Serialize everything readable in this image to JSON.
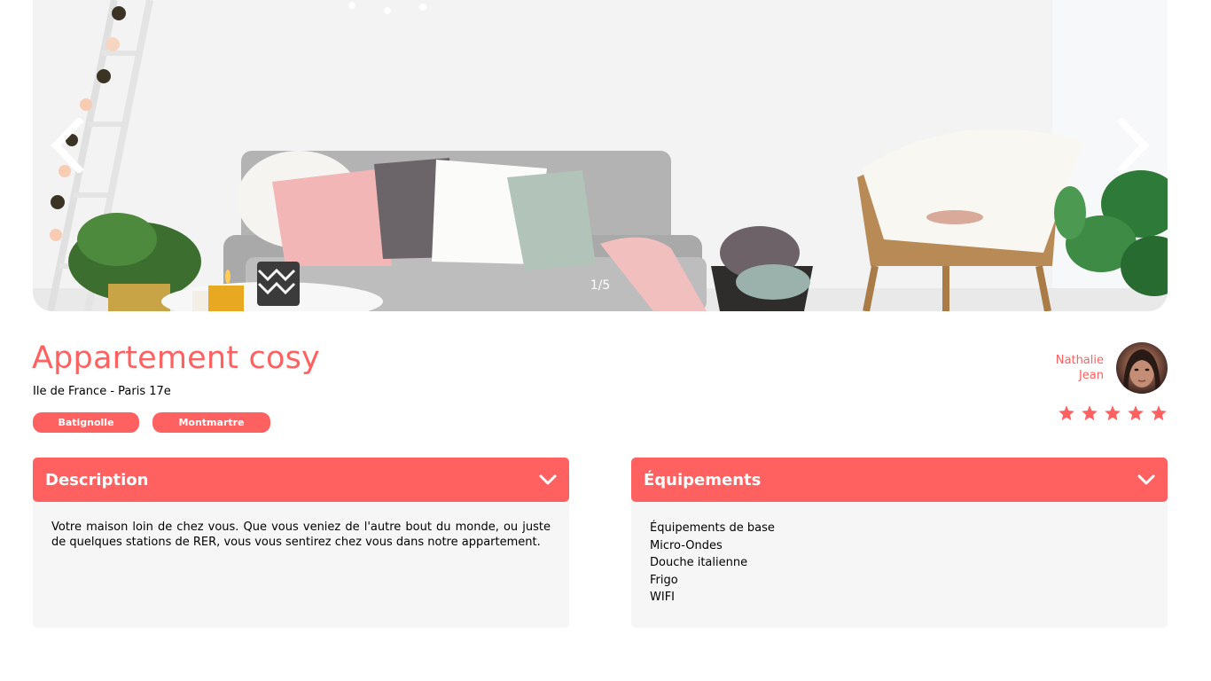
{
  "carousel": {
    "counter": "1/5",
    "prev_icon": "chevron-left-icon",
    "next_icon": "chevron-right-icon"
  },
  "listing": {
    "title": "Appartement cosy",
    "location": "Ile de France - Paris 17e",
    "tags": [
      "Batignolle",
      "Montmartre"
    ]
  },
  "host": {
    "first_name": "Nathalie",
    "last_name": "Jean"
  },
  "rating": {
    "value": 5,
    "max": 5
  },
  "description": {
    "title": "Description",
    "text": "Votre maison loin de chez vous. Que vous veniez de l'autre bout du monde, ou juste de quelques stations de RER, vous vous sentirez chez vous dans notre appartement."
  },
  "equipments": {
    "title": "Équipements",
    "items": [
      "Équipements de base",
      "Micro-Ondes",
      "Douche italienne",
      "Frigo",
      "WIFI"
    ]
  },
  "colors": {
    "accent": "#ff6060",
    "panel_bg": "#f6f6f6",
    "text": "#000000"
  }
}
